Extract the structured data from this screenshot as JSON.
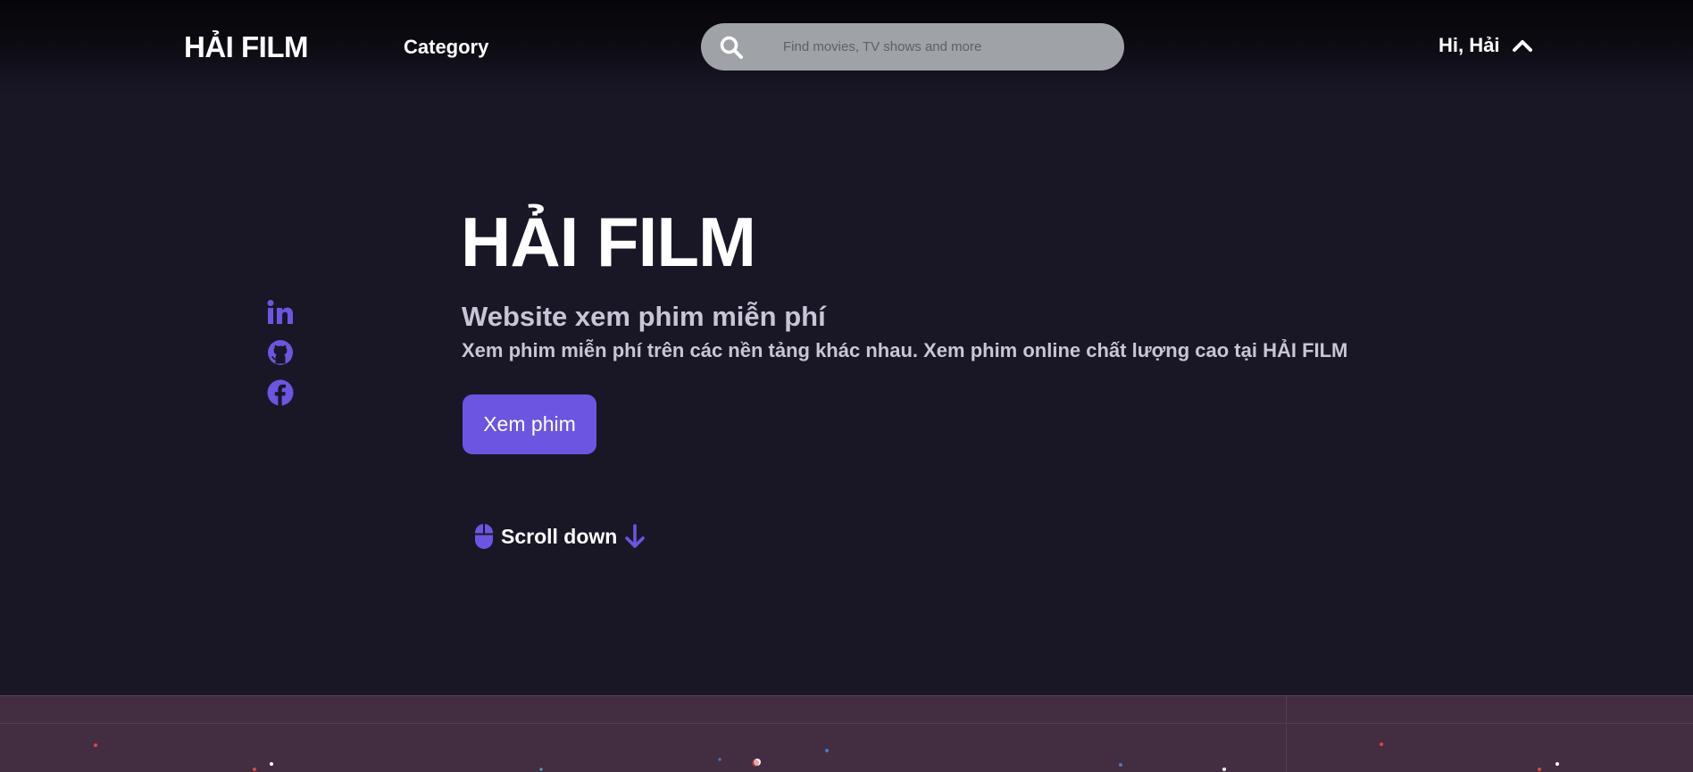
{
  "header": {
    "logo": "HẢI FILM",
    "category_label": "Category",
    "search": {
      "placeholder": "Find movies, TV shows and more",
      "value": ""
    },
    "user_greeting": "Hi, Hải"
  },
  "social": {
    "items": [
      {
        "icon": "linkedin-icon"
      },
      {
        "icon": "github-icon"
      },
      {
        "icon": "facebook-icon"
      }
    ]
  },
  "hero": {
    "title": "HẢI FILM",
    "subtitle": "Website xem phim miễn phí",
    "description": "Xem phim miễn phí trên các nền tảng khác nhau. Xem phim online chất lượng cao tại HẢI FILM",
    "cta_label": "Xem phim",
    "scroll_label": "Scroll down"
  },
  "colors": {
    "background": "#191726",
    "accent": "#6c55e0",
    "search_bg": "#9fa2a6",
    "banner_bg": "#432d40",
    "muted_text": "#c9c5d6"
  }
}
